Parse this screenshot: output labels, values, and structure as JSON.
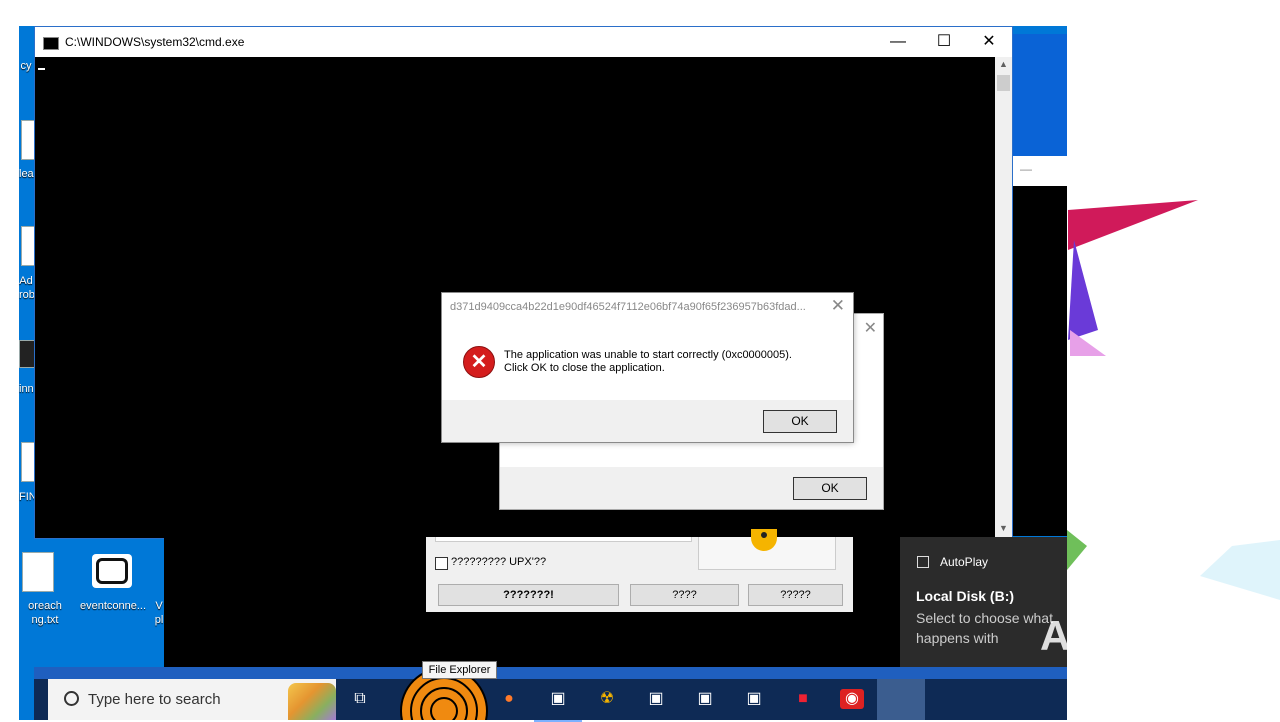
{
  "desktop": {
    "icons": [
      {
        "label": "cy",
        "type": "partial"
      },
      {
        "label": "lea",
        "type": "partial"
      },
      {
        "label": "Ad\nrob",
        "type": "partial"
      },
      {
        "label": "inn",
        "type": "partial"
      },
      {
        "label": "FIN",
        "type": "partial"
      },
      {
        "label": "oreach\nng.txt",
        "type": "text-file"
      },
      {
        "label": "eventconne...",
        "type": "app"
      },
      {
        "label": "V\npl",
        "type": "partial"
      }
    ]
  },
  "cmd_window": {
    "title": "C:\\WINDOWS\\system32\\cmd.exe",
    "minimize": "—",
    "maximize": "☐",
    "close": "✕"
  },
  "error_dialog": {
    "title": "d371d9409cca4b22d1e90df46524f7112e06bf74a90f65f236957b63fdad...",
    "close": "✕",
    "icon": "error-icon",
    "message_line1": "The application was unable to start correctly (0xc0000005).",
    "message_line2": "Click OK to close the application.",
    "ok_label": "OK"
  },
  "error_dialog_back": {
    "close": "✕",
    "ok_label": "OK"
  },
  "upx_dialog": {
    "checkbox_label": "????????? UPX'??",
    "buttons": [
      "???????!",
      "????",
      "?????"
    ]
  },
  "toast": {
    "app": "AutoPlay",
    "title": "Local Disk (B:)",
    "body": "Select to choose what happens with removable drives."
  },
  "taskbar": {
    "search_placeholder": "Type here to search",
    "tooltip": "File Explorer",
    "apps": [
      {
        "name": "task-view-icon",
        "glyph": "⧉"
      },
      {
        "name": "firefox-icon",
        "glyph": "●"
      },
      {
        "name": "window-app-icon",
        "glyph": "▣"
      },
      {
        "name": "radiation-app-icon",
        "glyph": "☢"
      },
      {
        "name": "window-app-icon",
        "glyph": "▣"
      },
      {
        "name": "window-app-icon",
        "glyph": "▣"
      },
      {
        "name": "window-app-icon",
        "glyph": "▣"
      },
      {
        "name": "colorful-app-icon",
        "glyph": "■"
      },
      {
        "name": "red-app-icon",
        "glyph": "◉"
      }
    ]
  },
  "watermark": "ANY RUN",
  "colors": {
    "desktop": "#0078d7",
    "taskbar": "#0e2a55",
    "error_red": "#d41d1d",
    "toast_bg": "#2b2b2b"
  }
}
